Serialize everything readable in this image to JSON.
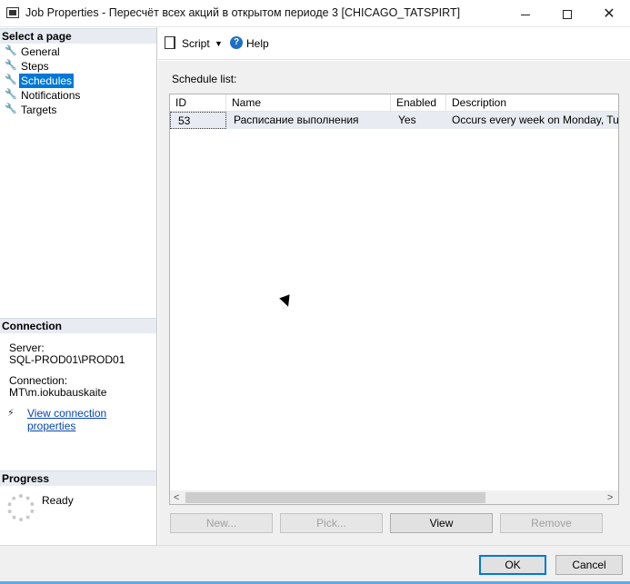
{
  "window": {
    "title": "Job Properties - Пересчёт всех акций в открытом периоде 3 [CHICAGO_TATSPIRT]"
  },
  "sidebar": {
    "select_page_header": "Select a page",
    "pages": [
      {
        "label": "General"
      },
      {
        "label": "Steps"
      },
      {
        "label": "Schedules"
      },
      {
        "label": "Notifications"
      },
      {
        "label": "Targets"
      }
    ],
    "selected_page": "Schedules",
    "connection_header": "Connection",
    "server_label": "Server:",
    "server_value": "SQL-PROD01\\PROD01",
    "connection_label": "Connection:",
    "connection_value": "MT\\m.iokubauskaite",
    "view_connection_link": "View connection properties",
    "progress_header": "Progress",
    "progress_status": "Ready"
  },
  "toolbar": {
    "script_label": "Script",
    "script_arrow": "▼",
    "help_label": "Help",
    "help_icon_glyph": "?"
  },
  "main": {
    "schedule_list_label": "Schedule list:",
    "columns": [
      "ID",
      "Name",
      "Enabled",
      "Description"
    ],
    "rows": [
      {
        "id": "53",
        "name": "Расписание выполнения",
        "enabled": "Yes",
        "description": "Occurs every week on Monday, Tuesday"
      }
    ],
    "buttons": {
      "new": "New...",
      "pick": "Pick...",
      "view": "View",
      "remove": "Remove"
    }
  },
  "footer": {
    "ok_label": "OK",
    "cancel_label": "Cancel"
  },
  "colors": {
    "selection": "#0078d7",
    "section_header_bg": "#e8ecf2",
    "link": "#0645ad"
  }
}
